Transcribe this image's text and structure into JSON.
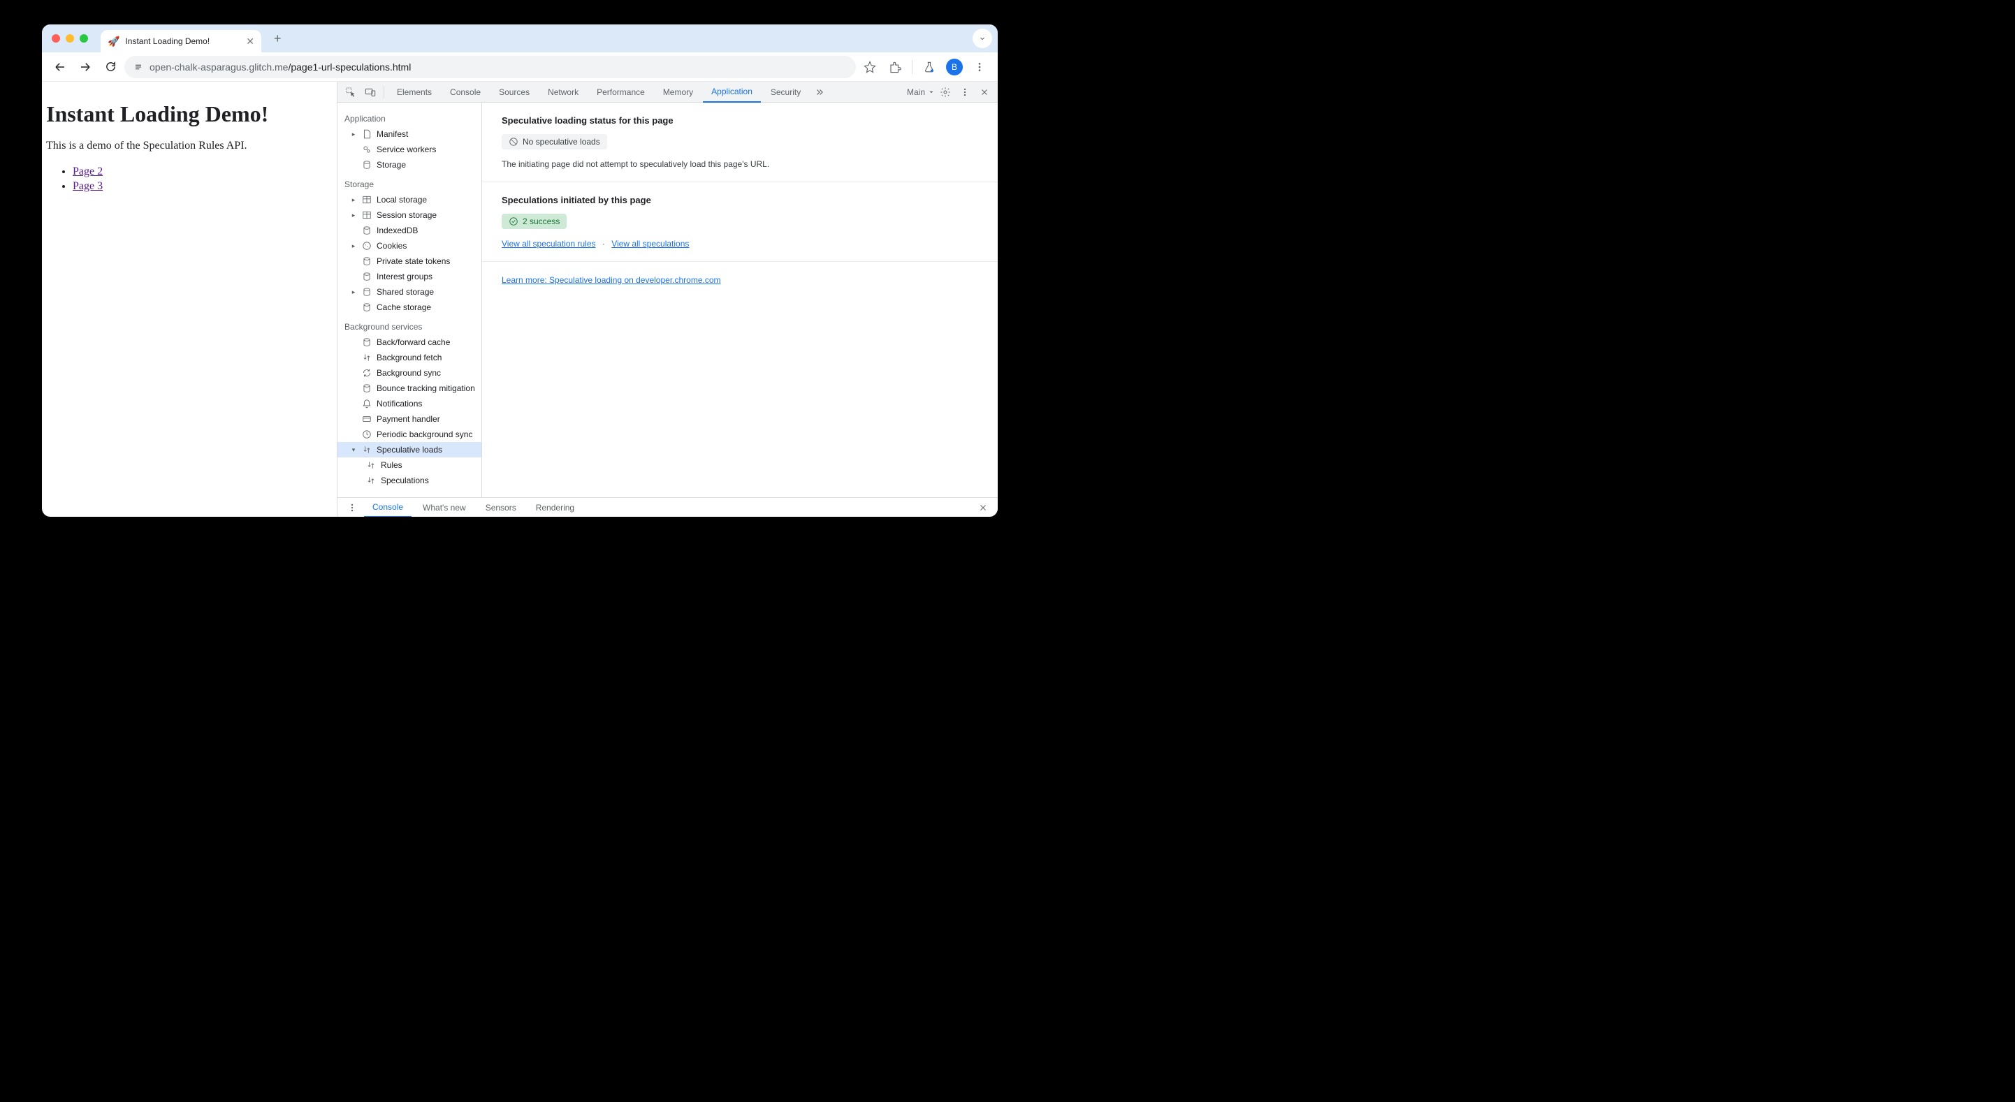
{
  "browser": {
    "tab_favicon": "🚀",
    "tab_title": "Instant Loading Demo!",
    "url_host": "open-chalk-asparagus.glitch.me",
    "url_path": "/page1-url-speculations.html",
    "avatar_letter": "B"
  },
  "page": {
    "heading": "Instant Loading Demo!",
    "description": "This is a demo of the Speculation Rules API.",
    "links": [
      "Page 2",
      "Page 3"
    ]
  },
  "devtools": {
    "tabs": [
      "Elements",
      "Console",
      "Sources",
      "Network",
      "Performance",
      "Memory",
      "Application",
      "Security"
    ],
    "active_tab": "Application",
    "frame_selector": "Main",
    "sidebar": {
      "application": {
        "label": "Application",
        "items": [
          "Manifest",
          "Service workers",
          "Storage"
        ]
      },
      "storage": {
        "label": "Storage",
        "items": [
          "Local storage",
          "Session storage",
          "IndexedDB",
          "Cookies",
          "Private state tokens",
          "Interest groups",
          "Shared storage",
          "Cache storage"
        ]
      },
      "background": {
        "label": "Background services",
        "items": [
          "Back/forward cache",
          "Background fetch",
          "Background sync",
          "Bounce tracking mitigation",
          "Notifications",
          "Payment handler",
          "Periodic background sync",
          "Speculative loads",
          "Rules",
          "Speculations"
        ]
      }
    },
    "panel": {
      "status_heading": "Speculative loading status for this page",
      "status_badge": "No speculative loads",
      "status_note": "The initiating page did not attempt to speculatively load this page's URL.",
      "initiated_heading": "Speculations initiated by this page",
      "initiated_badge": "2 success",
      "link_rules": "View all speculation rules",
      "link_specs": "View all speculations",
      "learn_more": "Learn more: Speculative loading on developer.chrome.com"
    },
    "drawer": {
      "tabs": [
        "Console",
        "What's new",
        "Sensors",
        "Rendering"
      ],
      "active": "Console"
    }
  }
}
